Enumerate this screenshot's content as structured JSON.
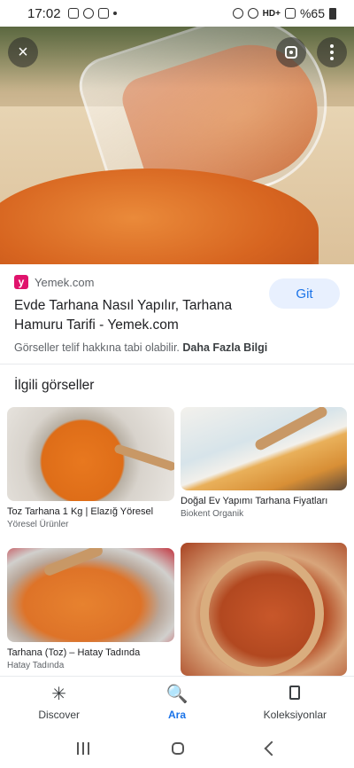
{
  "status_bar": {
    "time": "17:02",
    "network": "HD+",
    "battery": "%65"
  },
  "hero": {
    "close_icon": "×",
    "lens_icon": "google-lens-icon",
    "more_icon": "more-vert-icon"
  },
  "source": {
    "logo_letter": "y",
    "site_name": "Yemek.com",
    "visit_label": "Git",
    "title": "Evde Tarhana Nasıl Yapılır, Tarhana Hamuru Tarifi - Yemek.com",
    "copyright_text": "Görseller telif hakkına tabi olabilir.",
    "more_info": "Daha Fazla Bilgi"
  },
  "related": {
    "heading": "İlgili görseller",
    "items": [
      {
        "title": "Toz Tarhana 1 Kg | Elazığ Yöresel",
        "source": "Yöresel Ürünler"
      },
      {
        "title": "Doğal Ev Yapımı Tarhana Fiyatları",
        "source": "Biokent Organik"
      },
      {
        "title": "Tarhana (Toz) – Hatay Tadında",
        "source": "Hatay Tadında"
      },
      {
        "title": "",
        "source": ""
      }
    ]
  },
  "bottom_nav": {
    "items": [
      {
        "label": "Discover",
        "icon": "✳"
      },
      {
        "label": "Ara",
        "icon": "🔍"
      },
      {
        "label": "Koleksiyonlar",
        "icon": "bookmark-icon"
      }
    ]
  },
  "colors": {
    "accent": "#1a73e8",
    "visit_bg": "#e8f0fe",
    "brand_logo": "#e0136c"
  }
}
